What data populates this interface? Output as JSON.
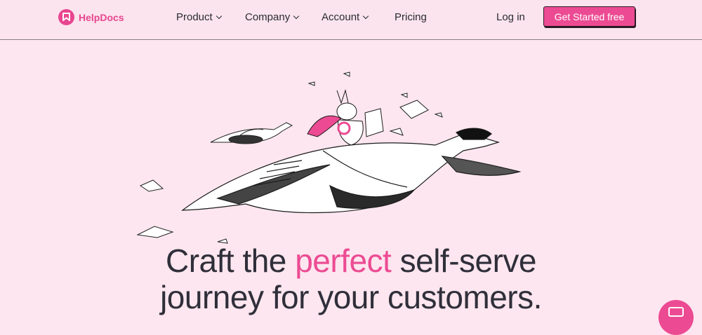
{
  "brand": {
    "name": "HelpDocs",
    "color": "#e8458f"
  },
  "nav": {
    "items": [
      {
        "label": "Product",
        "has_dropdown": true
      },
      {
        "label": "Company",
        "has_dropdown": true
      },
      {
        "label": "Account",
        "has_dropdown": true
      },
      {
        "label": "Pricing",
        "has_dropdown": false
      }
    ],
    "login_label": "Log in",
    "cta_label": "Get Started free"
  },
  "hero": {
    "headline_part1": "Craft the ",
    "headline_accent": "perfect",
    "headline_part2": " self-serve",
    "headline_line2": "journey for your customers."
  },
  "colors": {
    "background": "#fde6ef",
    "accent": "#ec4b93",
    "text": "#2f2f3a"
  }
}
